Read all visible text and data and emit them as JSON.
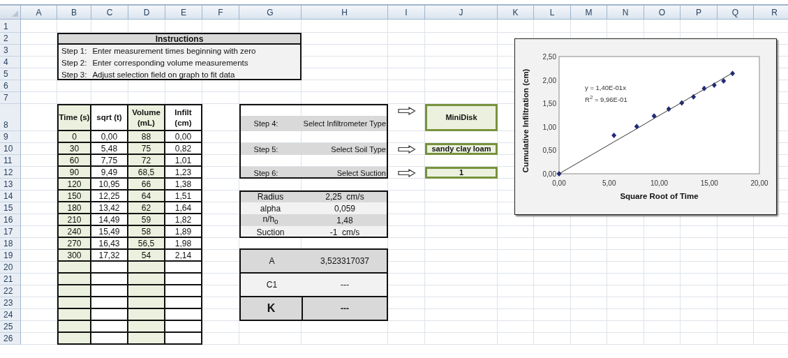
{
  "sheet": {
    "columns": [
      "A",
      "B",
      "C",
      "D",
      "E",
      "F",
      "G",
      "H",
      "I",
      "J",
      "K",
      "L",
      "M",
      "N",
      "O",
      "P",
      "Q",
      "R"
    ],
    "rows": [
      "1",
      "2",
      "3",
      "4",
      "5",
      "6",
      "7",
      "8",
      "9",
      "10",
      "11",
      "12",
      "13",
      "14",
      "15",
      "16",
      "17",
      "18",
      "19",
      "20",
      "21",
      "22",
      "23",
      "24",
      "25",
      "26"
    ]
  },
  "instructions": {
    "title": "Instructions",
    "steps": [
      {
        "label": "Step 1:",
        "text": "Enter measurement times beginning with zero"
      },
      {
        "label": "Step 2:",
        "text": "Enter corresponding volume measurements"
      },
      {
        "label": "Step 3:",
        "text": "Adjust selection field on graph to fit data"
      }
    ]
  },
  "data_table": {
    "columns": [
      {
        "label": "Time (s)",
        "kind": "input"
      },
      {
        "label": "sqrt (t)",
        "kind": "computed"
      },
      {
        "label": "Volume (mL)",
        "kind": "input"
      },
      {
        "label": "Infilt (cm)",
        "kind": "computed"
      }
    ],
    "rows": [
      [
        "0",
        "0,00",
        "88",
        "0,00"
      ],
      [
        "30",
        "5,48",
        "75",
        "0,82"
      ],
      [
        "60",
        "7,75",
        "72",
        "1,01"
      ],
      [
        "90",
        "9,49",
        "68,5",
        "1,23"
      ],
      [
        "120",
        "10,95",
        "66",
        "1,38"
      ],
      [
        "150",
        "12,25",
        "64",
        "1,51"
      ],
      [
        "180",
        "13,42",
        "62",
        "1,64"
      ],
      [
        "210",
        "14,49",
        "59",
        "1,82"
      ],
      [
        "240",
        "15,49",
        "58",
        "1,89"
      ],
      [
        "270",
        "16,43",
        "56,5",
        "1,98"
      ],
      [
        "300",
        "17,32",
        "54",
        "2,14"
      ]
    ]
  },
  "selections": [
    {
      "step": "Step 4:",
      "label": "Select Infiltrometer Type",
      "value": "MiniDisk"
    },
    {
      "step": "Step 5:",
      "label": "Select Soil Type",
      "value": "sandy clay loam"
    },
    {
      "step": "Step 6:",
      "label": "Select Suction",
      "value": "1"
    }
  ],
  "parameters": [
    {
      "name": "Radius",
      "value": "2,25  cm/s"
    },
    {
      "name": "alpha",
      "value": "0,059"
    },
    {
      "name": "n/h$_{o}$",
      "value": "1,48"
    },
    {
      "name": "Suction",
      "value": "-1  cm/s"
    }
  ],
  "results": [
    {
      "name": "A",
      "value": "3,523317037",
      "emphasized": false
    },
    {
      "name": "C1",
      "value": "---",
      "emphasized": false
    },
    {
      "name": "K",
      "value": "---",
      "emphasized": true
    }
  ],
  "chart": {
    "chart_data": {
      "type": "scatter",
      "xlabel": "Square Root of Time",
      "ylabel": "Cumulative Infiltration (cm)",
      "x": [
        0,
        5.48,
        7.75,
        9.49,
        10.95,
        12.25,
        13.42,
        14.49,
        15.49,
        16.43,
        17.32
      ],
      "series": [
        {
          "type": "scatter",
          "color": "#1f2a7a",
          "values": [
            0,
            0.82,
            1.01,
            1.23,
            1.38,
            1.51,
            1.64,
            1.82,
            1.89,
            1.98,
            2.14
          ]
        },
        {
          "type": "line",
          "color": "#333333",
          "values": [
            0,
            0.68,
            0.96,
            1.18,
            1.36,
            1.52,
            1.67,
            1.8,
            1.92,
            2.04,
            2.15
          ]
        }
      ],
      "xlim": [
        0,
        20
      ],
      "ylim": [
        0,
        2.5
      ],
      "xticks": [
        {
          "value": 0,
          "label": "0,00"
        },
        {
          "value": 5,
          "label": "5,00"
        },
        {
          "value": 10,
          "label": "10,00"
        },
        {
          "value": 15,
          "label": "15,00"
        },
        {
          "value": 20,
          "label": "20,00"
        }
      ],
      "yticks": [
        {
          "value": 0,
          "label": "0,00"
        },
        {
          "value": 0.5,
          "label": "0,50"
        },
        {
          "value": 1,
          "label": "1,00"
        },
        {
          "value": 1.5,
          "label": "1,50"
        },
        {
          "value": 2,
          "label": "2,00"
        },
        {
          "value": 2.5,
          "label": "2,50"
        }
      ],
      "annotations": [
        "y = 1,40E-01x",
        "R$^{2}$ = 9,96E-01"
      ]
    }
  }
}
